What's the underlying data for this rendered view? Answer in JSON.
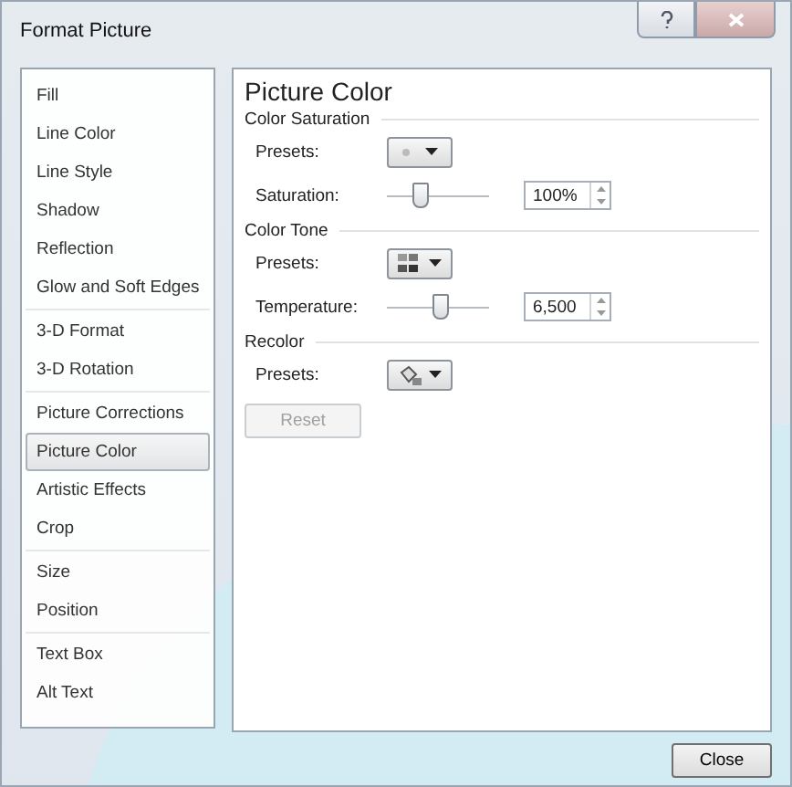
{
  "window": {
    "title": "Format Picture"
  },
  "sidebar": {
    "groups": [
      {
        "items": [
          {
            "label": "Fill",
            "selected": false
          },
          {
            "label": "Line Color",
            "selected": false
          },
          {
            "label": "Line Style",
            "selected": false
          },
          {
            "label": "Shadow",
            "selected": false
          },
          {
            "label": "Reflection",
            "selected": false
          },
          {
            "label": "Glow and Soft Edges",
            "selected": false
          }
        ]
      },
      {
        "items": [
          {
            "label": "3-D Format",
            "selected": false
          },
          {
            "label": "3-D Rotation",
            "selected": false
          }
        ]
      },
      {
        "items": [
          {
            "label": "Picture Corrections",
            "selected": false
          },
          {
            "label": "Picture Color",
            "selected": true
          },
          {
            "label": "Artistic Effects",
            "selected": false
          },
          {
            "label": "Crop",
            "selected": false
          }
        ]
      },
      {
        "items": [
          {
            "label": "Size",
            "selected": false
          },
          {
            "label": "Position",
            "selected": false
          }
        ]
      },
      {
        "items": [
          {
            "label": "Text Box",
            "selected": false
          },
          {
            "label": "Alt Text",
            "selected": false
          }
        ]
      }
    ]
  },
  "panel": {
    "title": "Picture Color",
    "sections": [
      {
        "title": "Color Saturation",
        "rows": [
          {
            "kind": "dotpresets",
            "label": "Presets:"
          },
          {
            "kind": "slider",
            "label": "Saturation:",
            "level": 0.33,
            "value": "100%"
          }
        ]
      },
      {
        "title": "Color Tone",
        "rows": [
          {
            "kind": "tonepresets",
            "label": "Presets:"
          },
          {
            "kind": "slider",
            "label": "Temperature:",
            "level": 0.52,
            "value": "6,500"
          }
        ]
      },
      {
        "title": "Recolor",
        "rows": [
          {
            "kind": "recolorpresets",
            "label": "Presets:"
          }
        ]
      }
    ],
    "reset": {
      "label": "Reset",
      "disabled": true
    }
  },
  "buttons": [
    {
      "label": "Close"
    }
  ]
}
